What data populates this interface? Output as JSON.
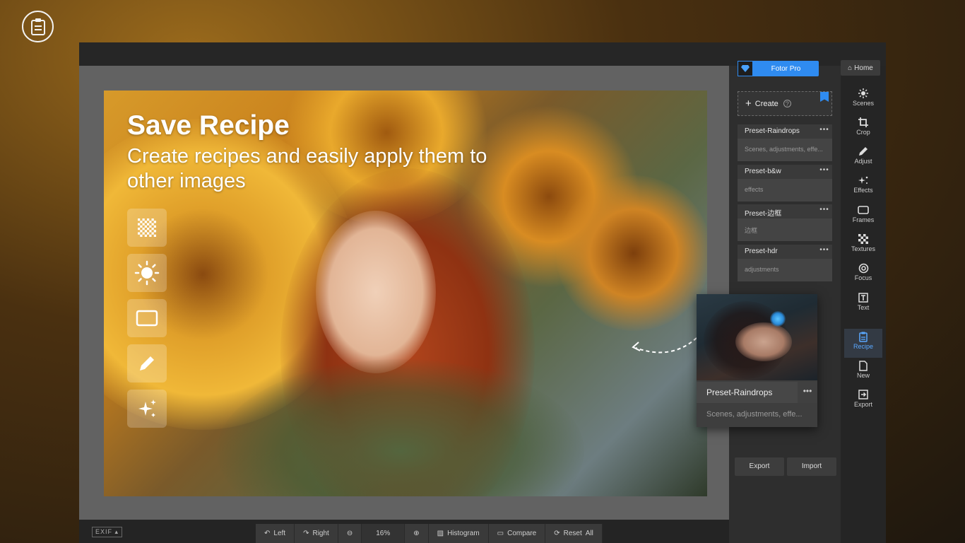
{
  "hero": {
    "title": "Save Recipe",
    "subtitle": "Create recipes and easily apply them to other images"
  },
  "tool_tiles": [
    "texture-icon",
    "sun-icon",
    "frame-icon",
    "pencil-icon",
    "sparkle-icon"
  ],
  "panel": {
    "pro_label": "Fotor Pro",
    "create_label": "Create",
    "presets": [
      {
        "name": "Preset-Raindrops",
        "desc": "Scenes, adjustments, effe...",
        "more": "•••"
      },
      {
        "name": "Preset-b&w",
        "desc": "effects",
        "more": "•••"
      },
      {
        "name": "Preset-边框",
        "desc": "边框",
        "more": "•••"
      },
      {
        "name": "Preset-hdr",
        "desc": "adjustments",
        "more": "•••"
      }
    ],
    "export_label": "Export",
    "import_label": "Import"
  },
  "rail": {
    "home_label": "Home",
    "items": [
      {
        "label": "Scenes",
        "icon": "scenes-icon"
      },
      {
        "label": "Crop",
        "icon": "crop-icon"
      },
      {
        "label": "Adjust",
        "icon": "adjust-icon"
      },
      {
        "label": "Effects",
        "icon": "effects-icon"
      },
      {
        "label": "Frames",
        "icon": "frames-icon"
      },
      {
        "label": "Textures",
        "icon": "textures-icon"
      },
      {
        "label": "Focus",
        "icon": "focus-icon"
      },
      {
        "label": "Text",
        "icon": "text-icon"
      },
      {
        "label": "Recipe",
        "icon": "recipe-icon"
      },
      {
        "label": "New",
        "icon": "new-icon"
      },
      {
        "label": "Export",
        "icon": "export-icon"
      }
    ],
    "active": "Recipe"
  },
  "floating_card": {
    "name": "Preset-Raindrops",
    "desc": "Scenes, adjustments, effe...",
    "more": "•••"
  },
  "bottom_bar": {
    "exif": "EXIF",
    "left": "Left",
    "right": "Right",
    "zoom": "16%",
    "histogram": "Histogram",
    "compare": "Compare",
    "reset": "Reset  All"
  },
  "colors": {
    "accent": "#2f8bf0",
    "panel_bg": "#2e2e2e",
    "canvas_bg": "#626262"
  }
}
